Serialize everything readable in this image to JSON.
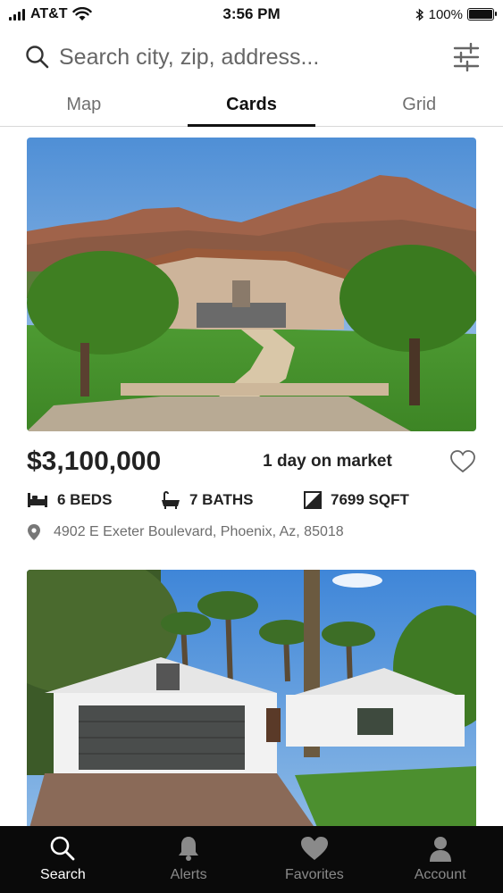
{
  "status_bar": {
    "carrier": "AT&T",
    "time": "3:56 PM",
    "battery": "100%"
  },
  "search": {
    "placeholder": "Search city, zip, address..."
  },
  "tabs": [
    {
      "label": "Map",
      "active": false
    },
    {
      "label": "Cards",
      "active": true
    },
    {
      "label": "Grid",
      "active": false
    }
  ],
  "listings": [
    {
      "price": "$3,100,000",
      "days_on_market": "1 day on market",
      "beds": "6 BEDS",
      "baths": "7 BATHS",
      "sqft": "7699 SQFT",
      "address": "4902 E Exeter Boulevard, Phoenix, Az, 85018",
      "favorited": false
    },
    {
      "photo": "white house with dark garage door and palm trees"
    }
  ],
  "bottom_nav": [
    {
      "label": "Search",
      "icon": "search-icon",
      "active": true
    },
    {
      "label": "Alerts",
      "icon": "bell-icon",
      "active": false
    },
    {
      "label": "Favorites",
      "icon": "heart-icon",
      "active": false
    },
    {
      "label": "Account",
      "icon": "person-icon",
      "active": false
    }
  ],
  "colors": {
    "nav_background": "#0a0a0a",
    "active_text": "#111111",
    "muted_text": "#6f6f6f"
  }
}
